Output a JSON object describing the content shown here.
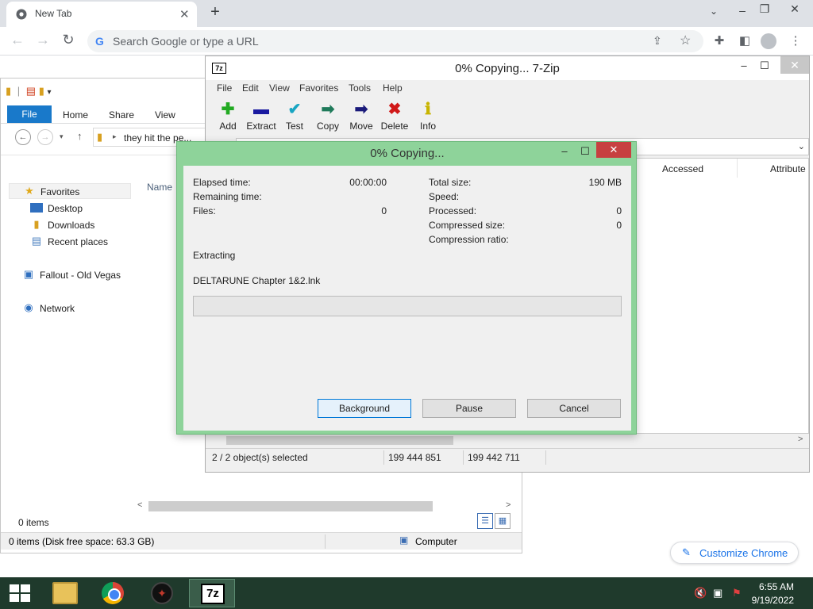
{
  "chrome": {
    "tab_title": "New Tab",
    "omnibox_placeholder": "Search Google or type a URL",
    "customize_label": "Customize Chrome"
  },
  "explorer": {
    "ribbon_tabs": [
      "File",
      "Home",
      "Share",
      "View"
    ],
    "address_path": "they hit the pe...",
    "nav_pane": {
      "favorites": "Favorites",
      "favorites_children": [
        "Desktop",
        "Downloads",
        "Recent places"
      ],
      "computer": "Fallout - Old Vegas",
      "network": "Network"
    },
    "column_name": "Name",
    "status_items": "0 items",
    "status_free_space": "0 items (Disk free space: 63.3 GB)",
    "status_location": "Computer"
  },
  "sevenzip": {
    "title": "0% Copying... 7-Zip",
    "menu": [
      "File",
      "Edit",
      "View",
      "Favorites",
      "Tools",
      "Help"
    ],
    "toolbar": [
      {
        "label": "Add",
        "icon": "plus-icon",
        "color": "#22aa22"
      },
      {
        "label": "Extract",
        "icon": "minus-icon",
        "color": "#1a1aa0"
      },
      {
        "label": "Test",
        "icon": "check-icon",
        "color": "#18a5c2"
      },
      {
        "label": "Copy",
        "icon": "copy-arrow-icon",
        "color": "#1f7a5a"
      },
      {
        "label": "Move",
        "icon": "move-arrow-icon",
        "color": "#1a1a7a"
      },
      {
        "label": "Delete",
        "icon": "delete-x-icon",
        "color": "#d01818"
      },
      {
        "label": "Info",
        "icon": "info-icon",
        "color": "#c8b400"
      }
    ],
    "columns": [
      "Accessed",
      "Attribute"
    ],
    "status": {
      "selected": "2 / 2 object(s) selected",
      "size": "199 444 851",
      "packed": "199 442 711"
    }
  },
  "progress": {
    "title": "0% Copying...",
    "elapsed_label": "Elapsed time:",
    "elapsed_value": "00:00:00",
    "remaining_label": "Remaining time:",
    "files_label": "Files:",
    "files_value": "0",
    "total_size_label": "Total size:",
    "total_size_value": "190 MB",
    "speed_label": "Speed:",
    "processed_label": "Processed:",
    "processed_value": "0",
    "compressed_label": "Compressed size:",
    "compressed_value": "0",
    "ratio_label": "Compression ratio:",
    "operation": "Extracting",
    "current_file": "DELTARUNE Chapter 1&2.lnk",
    "percent": 0,
    "buttons": {
      "background": "Background",
      "pause": "Pause",
      "cancel": "Cancel"
    }
  },
  "taskbar": {
    "time": "6:55 AM",
    "date": "9/19/2022",
    "zip_icon_text": "7z"
  }
}
